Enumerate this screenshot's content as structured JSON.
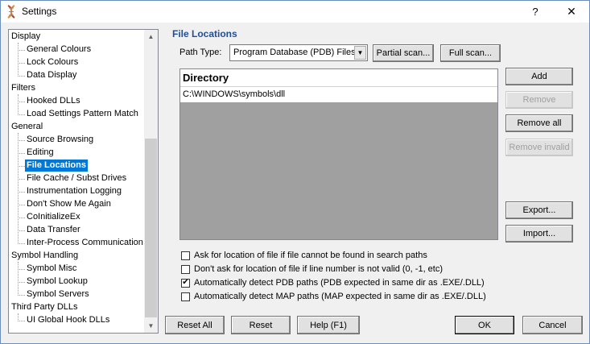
{
  "window": {
    "title": "Settings",
    "help_glyph": "?",
    "close_glyph": "✕"
  },
  "tree": {
    "items": [
      {
        "label": "Display",
        "level": 0
      },
      {
        "label": "General Colours",
        "level": 1
      },
      {
        "label": "Lock Colours",
        "level": 1
      },
      {
        "label": "Data Display",
        "level": 1
      },
      {
        "label": "Filters",
        "level": 0
      },
      {
        "label": "Hooked DLLs",
        "level": 1
      },
      {
        "label": "Load Settings Pattern Match",
        "level": 1
      },
      {
        "label": "General",
        "level": 0
      },
      {
        "label": "Source Browsing",
        "level": 1
      },
      {
        "label": "Editing",
        "level": 1
      },
      {
        "label": "File Locations",
        "level": 1,
        "selected": true
      },
      {
        "label": "File Cache / Subst Drives",
        "level": 1
      },
      {
        "label": "Instrumentation Logging",
        "level": 1
      },
      {
        "label": "Don't Show Me Again",
        "level": 1
      },
      {
        "label": "CoInitializeEx",
        "level": 1
      },
      {
        "label": "Data Transfer",
        "level": 1
      },
      {
        "label": "Inter-Process Communication",
        "level": 1
      },
      {
        "label": "Symbol Handling",
        "level": 0
      },
      {
        "label": "Symbol Misc",
        "level": 1
      },
      {
        "label": "Symbol Lookup",
        "level": 1
      },
      {
        "label": "Symbol Servers",
        "level": 1
      },
      {
        "label": "Third Party DLLs",
        "level": 0
      },
      {
        "label": "UI Global Hook DLLs",
        "level": 1
      }
    ]
  },
  "panel": {
    "title": "File Locations",
    "path_type_label": "Path Type:",
    "path_type_value": "Program Database (PDB) Files",
    "partial_scan": "Partial scan...",
    "full_scan": "Full scan...",
    "directory_header": "Directory",
    "directories": [
      "C:\\WINDOWS\\symbols\\dll"
    ],
    "add": "Add",
    "remove": "Remove",
    "remove_all": "Remove all",
    "remove_invalid": "Remove invalid",
    "export": "Export...",
    "import": "Import...",
    "options": [
      {
        "label": "Ask for location of file if file cannot be found in search paths",
        "checked": false
      },
      {
        "label": "Don't ask for location of file if line number is not valid (0, -1, etc)",
        "checked": false
      },
      {
        "label": "Automatically detect PDB paths (PDB expected in same dir as .EXE/.DLL)",
        "checked": true
      },
      {
        "label": "Automatically detect MAP paths (MAP expected in same dir as .EXE/.DLL)",
        "checked": false
      }
    ]
  },
  "footer": {
    "reset_all": "Reset All",
    "reset": "Reset",
    "help": "Help (F1)",
    "ok": "OK",
    "cancel": "Cancel"
  },
  "colors": {
    "selection": "#0078d7",
    "section_title": "#1f4e96"
  }
}
